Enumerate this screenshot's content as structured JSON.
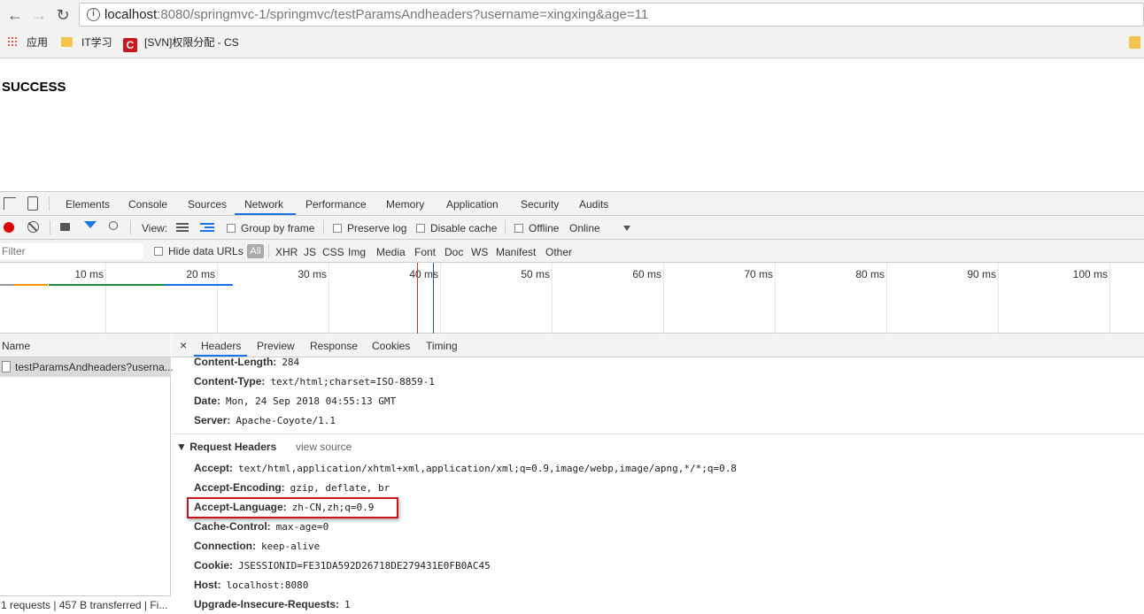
{
  "browser": {
    "url_host": "localhost",
    "url_rest": ":8080/springmvc-1/springmvc/testParamsAndheaders?username=xingxing&age=11",
    "bookmarks": [
      {
        "label": "应用"
      },
      {
        "label": "IT学习"
      },
      {
        "label": "[SVN]权限分配 - CS",
        "icon": "C"
      }
    ]
  },
  "page": {
    "title": "SUCCESS"
  },
  "devtools": {
    "tabs": [
      "Elements",
      "Console",
      "Sources",
      "Network",
      "Performance",
      "Memory",
      "Application",
      "Security",
      "Audits"
    ],
    "active_tab": "Network",
    "toolbar": {
      "view_label": "View:",
      "group_by_frame": "Group by frame",
      "preserve_log": "Preserve log",
      "disable_cache": "Disable cache",
      "offline": "Offline",
      "throttle": "Online"
    },
    "filterbar": {
      "placeholder": "Filter",
      "hide_data_urls": "Hide data URLs",
      "types": [
        "All",
        "XHR",
        "JS",
        "CSS",
        "Img",
        "Media",
        "Font",
        "Doc",
        "WS",
        "Manifest",
        "Other"
      ]
    },
    "timeline": {
      "ticks": [
        "10 ms",
        "20 ms",
        "30 ms",
        "40 ms",
        "50 ms",
        "60 ms",
        "70 ms",
        "80 ms",
        "90 ms",
        "100 ms"
      ]
    },
    "requests": {
      "column_name": "Name",
      "rows": [
        "testParamsAndheaders?userna..."
      ],
      "status": "1 requests  |  457 B transferred  |  Fi..."
    },
    "detail": {
      "tabs": [
        "Headers",
        "Preview",
        "Response",
        "Cookies",
        "Timing"
      ],
      "close_glyph": "×",
      "response_headers": [
        {
          "k": "Content-Length:",
          "v": "284"
        },
        {
          "k": "Content-Type:",
          "v": "text/html;charset=ISO-8859-1"
        },
        {
          "k": "Date:",
          "v": "Mon, 24 Sep 2018 04:55:13 GMT"
        },
        {
          "k": "Server:",
          "v": "Apache-Coyote/1.1"
        }
      ],
      "request_section": {
        "title": "▼ Request Headers",
        "view_source": "view source"
      },
      "request_headers": [
        {
          "k": "Accept:",
          "v": "text/html,application/xhtml+xml,application/xml;q=0.9,image/webp,image/apng,*/*;q=0.8"
        },
        {
          "k": "Accept-Encoding:",
          "v": "gzip, deflate, br"
        },
        {
          "k": "Accept-Language:",
          "v": "zh-CN,zh;q=0.9"
        },
        {
          "k": "Cache-Control:",
          "v": "max-age=0"
        },
        {
          "k": "Connection:",
          "v": "keep-alive"
        },
        {
          "k": "Cookie:",
          "v": "JSESSIONID=FE31DA592D26718DE279431E0FB0AC45"
        },
        {
          "k": "Host:",
          "v": "localhost:8080"
        },
        {
          "k": "Upgrade-Insecure-Requests:",
          "v": "1"
        }
      ]
    }
  }
}
